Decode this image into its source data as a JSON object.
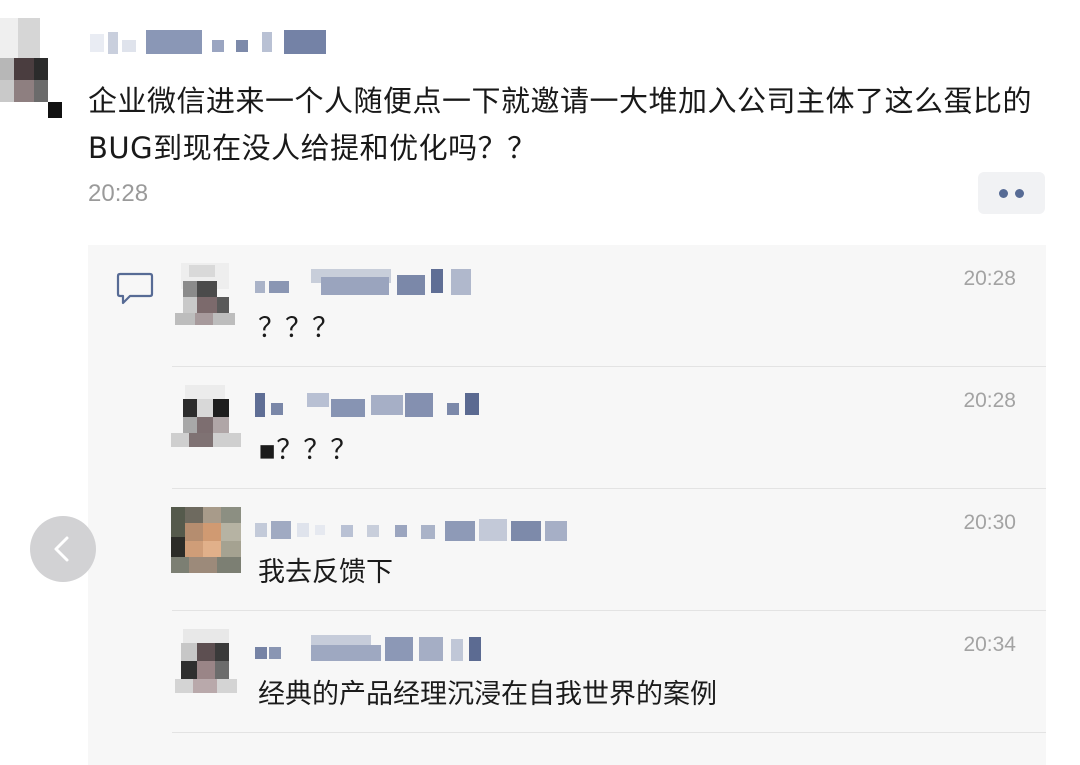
{
  "post": {
    "text": "企业微信进来一个人随便点一下就邀请一大堆加入公司主体了这么蛋比的BUG到现在没人给提和优化吗？？",
    "time": "20:28"
  },
  "comments": [
    {
      "text": "？？？",
      "time": "20:28"
    },
    {
      "text": "▪？？？",
      "time": "20:28"
    },
    {
      "text": "我去反馈下",
      "time": "20:30"
    },
    {
      "text": "经典的产品经理沉浸在自我世界的案例",
      "time": "20:34"
    }
  ],
  "icons": {
    "more": "more-dots-icon",
    "comment": "comment-bubble-icon",
    "back": "chevron-left-icon"
  },
  "colors": {
    "link": "#576b95",
    "timestamp": "#9a9a9a",
    "panel": "#f7f7f7"
  }
}
